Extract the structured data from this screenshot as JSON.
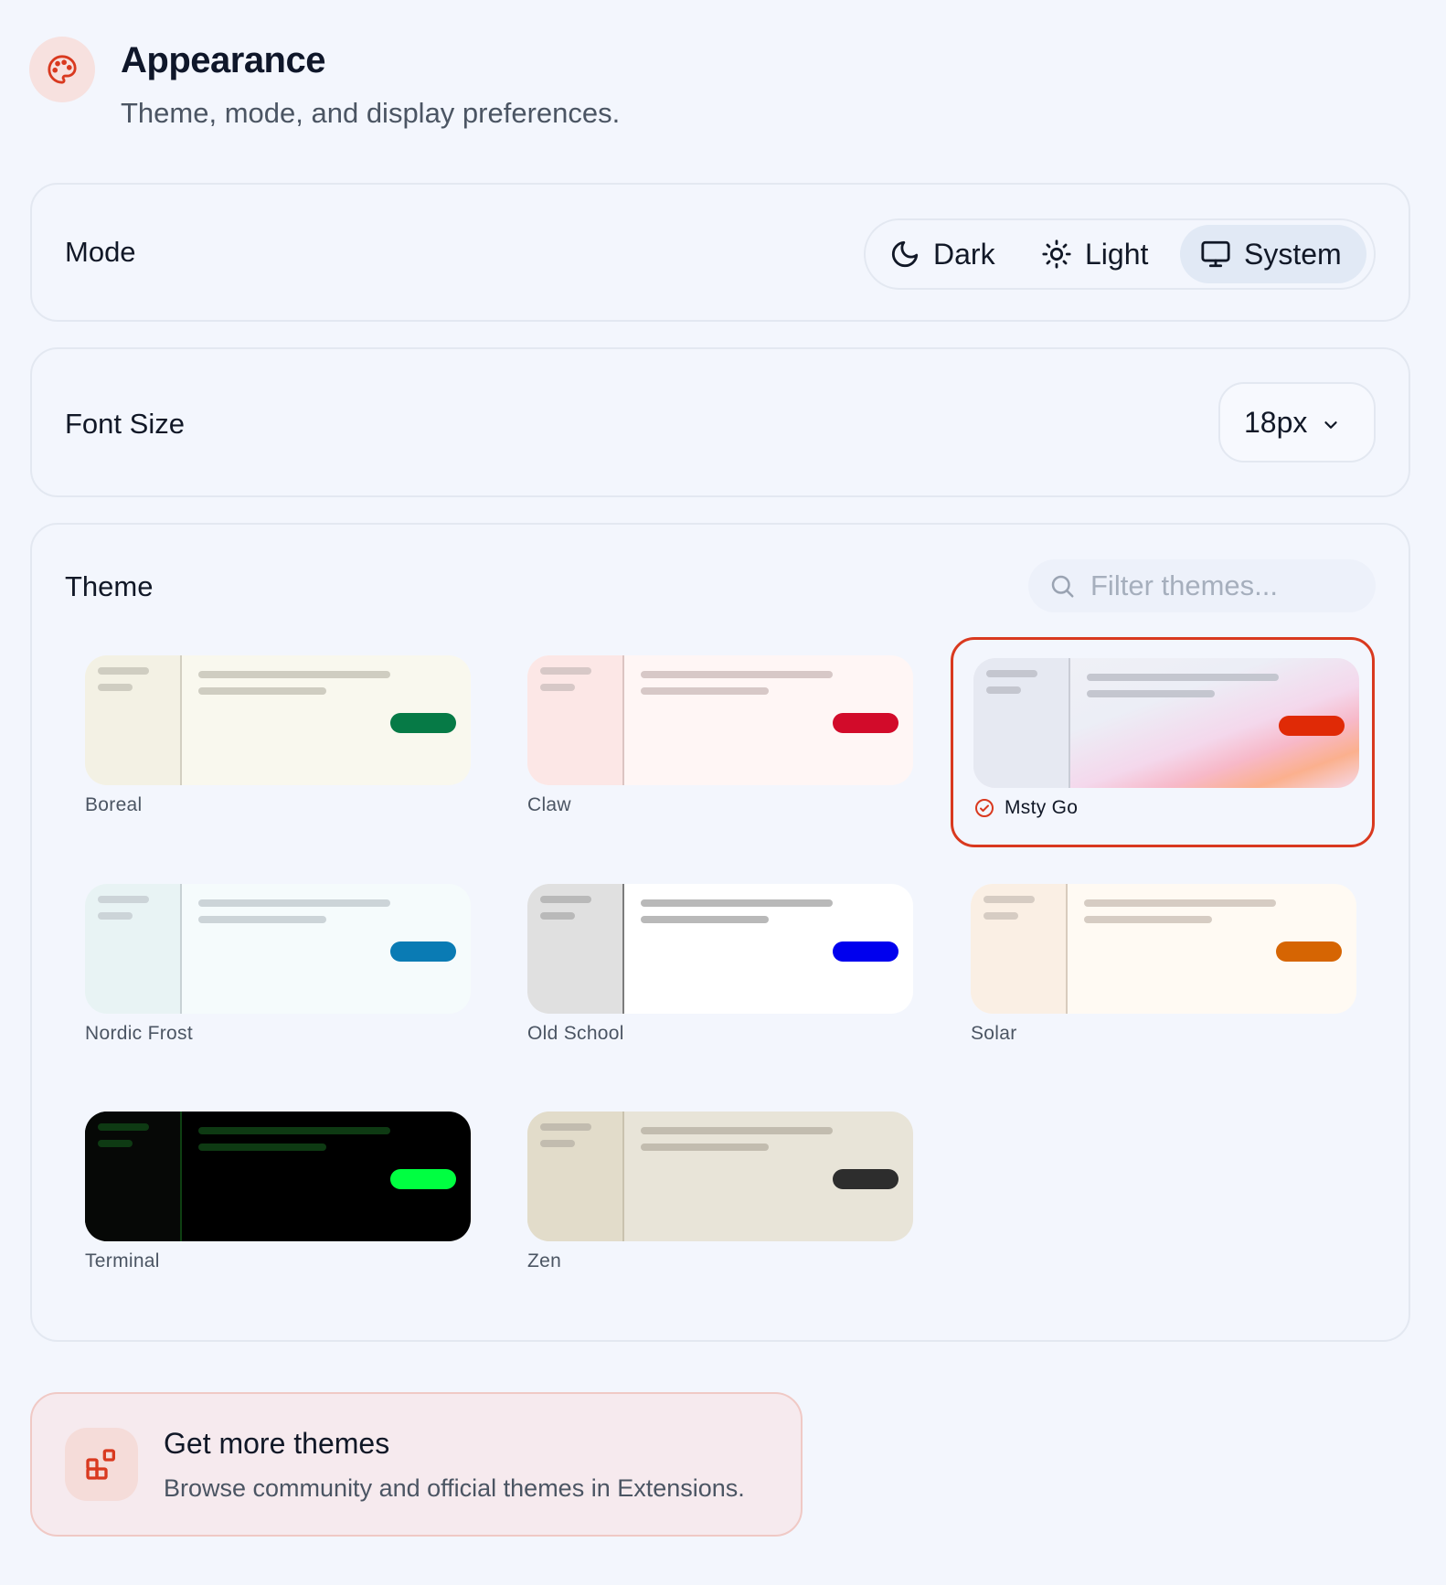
{
  "header": {
    "title": "Appearance",
    "subtitle": "Theme, mode, and display preferences.",
    "icon": "palette-icon"
  },
  "mode": {
    "label": "Mode",
    "options": [
      {
        "label": "Dark",
        "icon": "moon-icon"
      },
      {
        "label": "Light",
        "icon": "sun-icon"
      },
      {
        "label": "System",
        "icon": "monitor-icon"
      }
    ],
    "selected": "System"
  },
  "font_size": {
    "label": "Font Size",
    "value": "18px"
  },
  "theme": {
    "label": "Theme",
    "filter_placeholder": "Filter themes...",
    "selected": "Msty Go",
    "accent_color": "#d9391f",
    "themes": [
      {
        "name": "Boreal",
        "accent": "#067a46",
        "side": "#f3f1e4",
        "main": "#f9f8ee",
        "divider": "#d3cfc1",
        "bar": "#cfcdc1"
      },
      {
        "name": "Claw",
        "accent": "#d20b2a",
        "side": "#fce7e6",
        "main": "#fff6f5",
        "divider": "#dcc4c2",
        "bar": "#d7c8c7"
      },
      {
        "name": "Msty Go",
        "accent": "#e02a06",
        "side": "#e6e9f2",
        "main": "#f1f1f7",
        "divider": "#c9ccd6",
        "bar": "#c4c6cf"
      },
      {
        "name": "Nordic Frost",
        "accent": "#0a7bb4",
        "side": "#e8f3f4",
        "main": "#f5fbfc",
        "divider": "#c8d2d5",
        "bar": "#ccd4d8"
      },
      {
        "name": "Old School",
        "accent": "#0000ee",
        "side": "#e0e0e0",
        "main": "#ffffff",
        "divider": "#7c7c7c",
        "bar": "#b9b9b9"
      },
      {
        "name": "Solar",
        "accent": "#d66503",
        "side": "#faefe4",
        "main": "#fffaf3",
        "divider": "#d8cbbd",
        "bar": "#d6ccc3"
      },
      {
        "name": "Terminal",
        "accent": "#00ff41",
        "side": "#060806",
        "main": "#000000",
        "divider": "#0e4012",
        "bar": "#0e3a13"
      },
      {
        "name": "Zen",
        "accent": "#2d2d2d",
        "side": "#e2dcca",
        "main": "#e8e4d8",
        "divider": "#c9c2ae",
        "bar": "#c2bcaf"
      }
    ]
  },
  "extensions": {
    "title": "Get more themes",
    "description": "Browse community and official themes in Extensions.",
    "icon": "extensions-icon"
  }
}
